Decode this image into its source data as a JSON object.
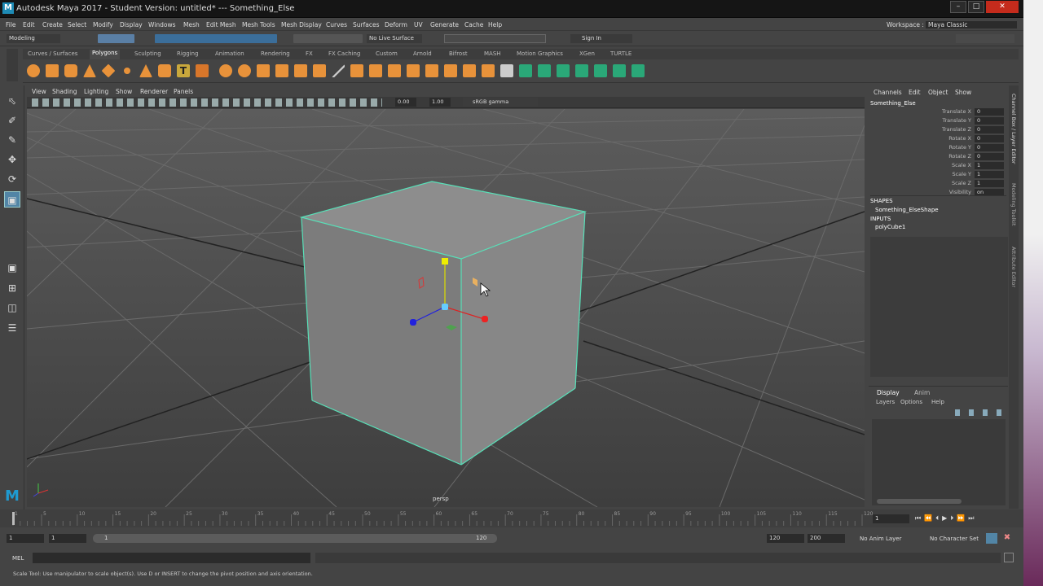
{
  "window": {
    "title": "Autodesk Maya 2017 - Student Version: untitled*   ---   Something_Else",
    "logo_letter": "M"
  },
  "workspace": {
    "label": "Workspace :",
    "value": "Maya Classic"
  },
  "menus": [
    "File",
    "Edit",
    "Create",
    "Select",
    "Modify",
    "Display",
    "Windows",
    "Mesh",
    "Edit Mesh",
    "Mesh Tools",
    "Mesh Display",
    "Curves",
    "Surfaces",
    "Deform",
    "UV",
    "Generate",
    "Cache",
    "Help"
  ],
  "status": {
    "mode": "Modeling",
    "live_surface": "No Live Surface",
    "sign_in": "Sign In"
  },
  "shelf_tabs": [
    "Curves / Surfaces",
    "Polygons",
    "Sculpting",
    "Rigging",
    "Animation",
    "Rendering",
    "FX",
    "FX Caching",
    "Custom",
    "Arnold",
    "Bifrost",
    "MASH",
    "Motion Graphics",
    "XGen",
    "TURTLE"
  ],
  "shelf_active": "Polygons",
  "panel_menu": [
    "View",
    "Shading",
    "Lighting",
    "Show",
    "Renderer",
    "Panels"
  ],
  "panel_toolbar": {
    "exposure": "0.00",
    "gamma": "1.00",
    "color_space": "sRGB gamma"
  },
  "viewport": {
    "camera_label": "persp"
  },
  "channel_box": {
    "menu": [
      "Channels",
      "Edit",
      "Object",
      "Show"
    ],
    "object_name": "Something_Else",
    "attributes": [
      {
        "name": "Translate X",
        "value": "0"
      },
      {
        "name": "Translate Y",
        "value": "0"
      },
      {
        "name": "Translate Z",
        "value": "0"
      },
      {
        "name": "Rotate X",
        "value": "0"
      },
      {
        "name": "Rotate Y",
        "value": "0"
      },
      {
        "name": "Rotate Z",
        "value": "0"
      },
      {
        "name": "Scale X",
        "value": "1"
      },
      {
        "name": "Scale Y",
        "value": "1"
      },
      {
        "name": "Scale Z",
        "value": "1"
      },
      {
        "name": "Visibility",
        "value": "on"
      }
    ],
    "shapes_header": "SHAPES",
    "shape_name": "Something_ElseShape",
    "inputs_header": "INPUTS",
    "input_name": "polyCube1"
  },
  "side_tabs": [
    "Channel Box / Layer Editor",
    "Modeling Toolkit",
    "Attribute Editor"
  ],
  "layer_editor": {
    "tabs": [
      "Display",
      "Anim"
    ],
    "menu": [
      "Layers",
      "Options",
      "Help"
    ]
  },
  "time_slider": {
    "ticks": [
      "1",
      "5",
      "10",
      "15",
      "20",
      "25",
      "30",
      "35",
      "40",
      "45",
      "50",
      "55",
      "60",
      "65",
      "70",
      "75",
      "80",
      "85",
      "90",
      "95",
      "100",
      "105",
      "110",
      "115",
      "120"
    ],
    "current_frame": "1"
  },
  "range": {
    "start": "1",
    "playback_start": "1",
    "range_left": "1",
    "range_right": "120",
    "end": "120",
    "anim_end": "200",
    "anim_layer": "No Anim Layer",
    "character_set": "No Character Set"
  },
  "command_line": {
    "label": "MEL"
  },
  "help_line": "Scale Tool: Use manipulator to scale object(s). Use D or INSERT to change the pivot position and axis orientation."
}
